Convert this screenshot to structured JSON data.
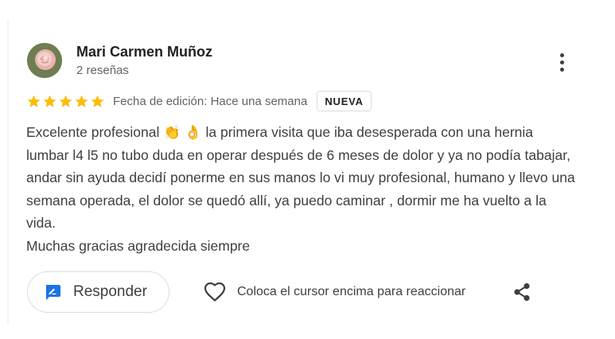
{
  "review": {
    "author": {
      "name": "Mari Carmen Muñoz",
      "review_count": "2 reseñas",
      "avatar_icon": "rose-photo-avatar"
    },
    "rating": 5,
    "rating_max": 5,
    "star_color": "#fbbc04",
    "edit_date": "Fecha de edición: Hace una semana",
    "badge": "NUEVA",
    "text": "Excelente profesional 👏  👌 la primera visita que iba desesperada con una hernia lumbar l4 l5 no tubo duda en operar después de 6 meses de dolor y ya no podía tabajar, andar sin ayuda decidí ponerme en sus manos lo vi muy profesional, humano y llevo una semana operada, el dolor se quedó allí, ya puedo caminar , dormir me ha vuelto a la vida.\nMuchas gracias agradecida siempre"
  },
  "actions": {
    "reply_label": "Responder",
    "reply_icon": "reply-edit-icon",
    "react_hint": "Coloca el cursor encima para reaccionar",
    "react_icon": "heart-icon",
    "share_icon": "share-icon",
    "more_icon": "more-vertical-icon"
  },
  "colors": {
    "accent_blue": "#1a73e8"
  }
}
